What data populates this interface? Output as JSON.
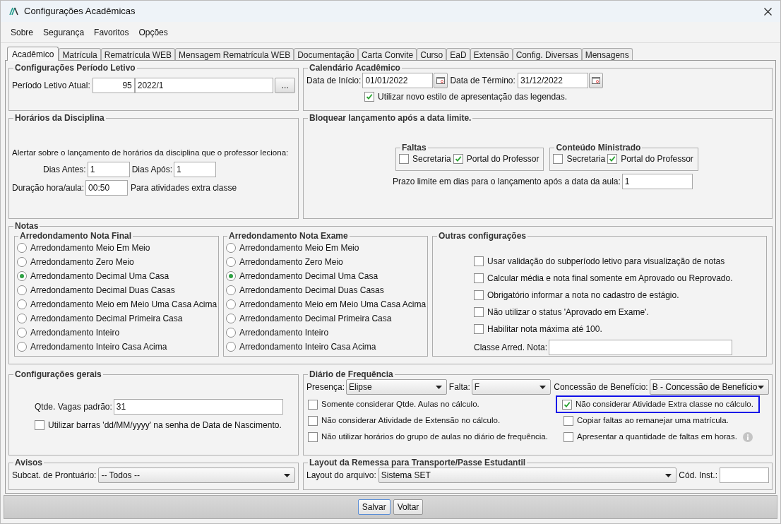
{
  "window": {
    "title": "Configurações Acadêmicas"
  },
  "menu": [
    "Sobre",
    "Segurança",
    "Favoritos",
    "Opções"
  ],
  "tabs": [
    {
      "label": "Acadêmico",
      "selected": true
    },
    {
      "label": "Matrícula",
      "selected": false
    },
    {
      "label": "Rematrícula WEB",
      "selected": false
    },
    {
      "label": "Mensagem Rematrícula WEB",
      "selected": false
    },
    {
      "label": "Documentação",
      "selected": false
    },
    {
      "label": "Carta Convite",
      "selected": false
    },
    {
      "label": "Curso",
      "selected": false
    },
    {
      "label": "EaD",
      "selected": false
    },
    {
      "label": "Extensão",
      "selected": false
    },
    {
      "label": "Config. Diversas",
      "selected": false
    },
    {
      "label": "Mensagens",
      "selected": false
    }
  ],
  "periodo_letivo": {
    "title": "Configurações Período Letivo",
    "label": "Período Letivo Atual:",
    "code": "95",
    "value": "2022/1",
    "browse_button": "..."
  },
  "calendario": {
    "title": "Calendário Acadêmico",
    "start_label": "Data de Início:",
    "start_value": "01/01/2022",
    "end_label": "Data de Término:",
    "end_value": "31/12/2022",
    "legend_style": {
      "label": "Utilizar novo estilo de apresentação das legendas.",
      "checked": true
    }
  },
  "horarios": {
    "title": "Horários da Disciplina",
    "alert_text": "Alertar sobre o lançamento de horários da disciplina que o professor leciona:",
    "days_before_label": "Dias Antes:",
    "days_before": "1",
    "days_after_label": "Dias Após:",
    "days_after": "1",
    "duration_label": "Duração hora/aula:",
    "duration": "00:50",
    "duration_note": "Para atividades extra classe"
  },
  "bloquear": {
    "title": "Bloquear lançamento após a data limite.",
    "groups": [
      {
        "title": "Faltas",
        "options": [
          {
            "label": "Secretaria",
            "checked": false
          },
          {
            "label": "Portal do Professor",
            "checked": true
          }
        ]
      },
      {
        "title": "Conteúdo Ministrado",
        "options": [
          {
            "label": "Secretaria",
            "checked": false
          },
          {
            "label": "Portal do Professor",
            "checked": true
          }
        ]
      }
    ],
    "limit_label": "Prazo limite em dias para o lançamento após a data da aula:",
    "limit_value": "1"
  },
  "notas": {
    "title": "Notas",
    "rounding_groups": [
      {
        "title": "Arredondamento Nota Final",
        "options": [
          {
            "label": "Arredondamento Meio Em Meio",
            "selected": false
          },
          {
            "label": "Arredondamento Zero Meio",
            "selected": false
          },
          {
            "label": "Arredondamento Decimal Uma Casa",
            "selected": true
          },
          {
            "label": "Arredondamento Decimal Duas Casas",
            "selected": false
          },
          {
            "label": "Arredondamento Meio em Meio Uma Casa Acima",
            "selected": false
          },
          {
            "label": "Arredondamento Decimal Primeira Casa",
            "selected": false
          },
          {
            "label": "Arredondamento Inteiro",
            "selected": false
          },
          {
            "label": "Arredondamento Inteiro Casa Acima",
            "selected": false
          }
        ]
      },
      {
        "title": "Arredondamento Nota Exame",
        "options": [
          {
            "label": "Arredondamento Meio Em Meio",
            "selected": false
          },
          {
            "label": "Arredondamento Zero Meio",
            "selected": false
          },
          {
            "label": "Arredondamento Decimal Uma Casa",
            "selected": true
          },
          {
            "label": "Arredondamento Decimal Duas Casas",
            "selected": false
          },
          {
            "label": "Arredondamento Meio em Meio Uma Casa Acima",
            "selected": false
          },
          {
            "label": "Arredondamento Decimal Primeira Casa",
            "selected": false
          },
          {
            "label": "Arredondamento Inteiro",
            "selected": false
          },
          {
            "label": "Arredondamento Inteiro Casa Acima",
            "selected": false
          }
        ]
      }
    ],
    "others": {
      "title": "Outras configurações",
      "options": [
        {
          "label": "Usar validação do subperíodo letivo para visualização de notas",
          "checked": false
        },
        {
          "label": "Calcular média e nota final somente em Aprovado ou Reprovado.",
          "checked": false
        },
        {
          "label": "Obrigatório informar a nota no cadastro de estágio.",
          "checked": false
        },
        {
          "label": "Não utilizar o status 'Aprovado em Exame'.",
          "checked": false
        },
        {
          "label": "Habilitar nota máxima até 100.",
          "checked": false
        }
      ],
      "class_label": "Classe Arred. Nota:"
    }
  },
  "config_gerais": {
    "title": "Configurações gerais",
    "vagas_label": "Qtde. Vagas padrão:",
    "vagas_value": "31",
    "barras": {
      "label": "Utilizar barras 'dd/MM/yyyy' na senha de Data de Nascimento.",
      "checked": false
    }
  },
  "diario": {
    "title": "Diário de Frequência",
    "selects": [
      {
        "label": "Presença:",
        "value": "Elipse"
      },
      {
        "label": "Falta:",
        "value": "F"
      },
      {
        "label": "Concessão de Benefício:",
        "value": "B - Concessão de Benefício"
      }
    ],
    "options": [
      {
        "label": "Somente considerar Qtde. Aulas no cálculo.",
        "checked": false,
        "highlighted": false,
        "info": false
      },
      {
        "label": "Não considerar Atividade Extra classe no cálculo.",
        "checked": true,
        "highlighted": true,
        "info": false
      },
      {
        "label": "Não considerar Atividade de Extensão no cálculo.",
        "checked": false,
        "highlighted": false,
        "info": false
      },
      {
        "label": "Copiar faltas ao remanejar uma matrícula.",
        "checked": false,
        "highlighted": false,
        "info": false
      },
      {
        "label": "Não utilizar horários do grupo de aulas no diário de frequência.",
        "checked": false,
        "highlighted": false,
        "info": false
      },
      {
        "label": "Apresentar a quantidade de faltas em horas.",
        "checked": false,
        "highlighted": false,
        "info": true
      }
    ]
  },
  "avisos": {
    "title": "Avisos",
    "label": "Subcat. de Prontuário:",
    "value": "-- Todos --"
  },
  "layout_remessa": {
    "title": "Layout da Remessa para Transporte/Passe Estudantil",
    "label": "Layout do arquivo:",
    "value": "Sistema SET",
    "code_label": "Cód. Inst.:"
  },
  "buttons": [
    "Salvar",
    "Voltar"
  ]
}
